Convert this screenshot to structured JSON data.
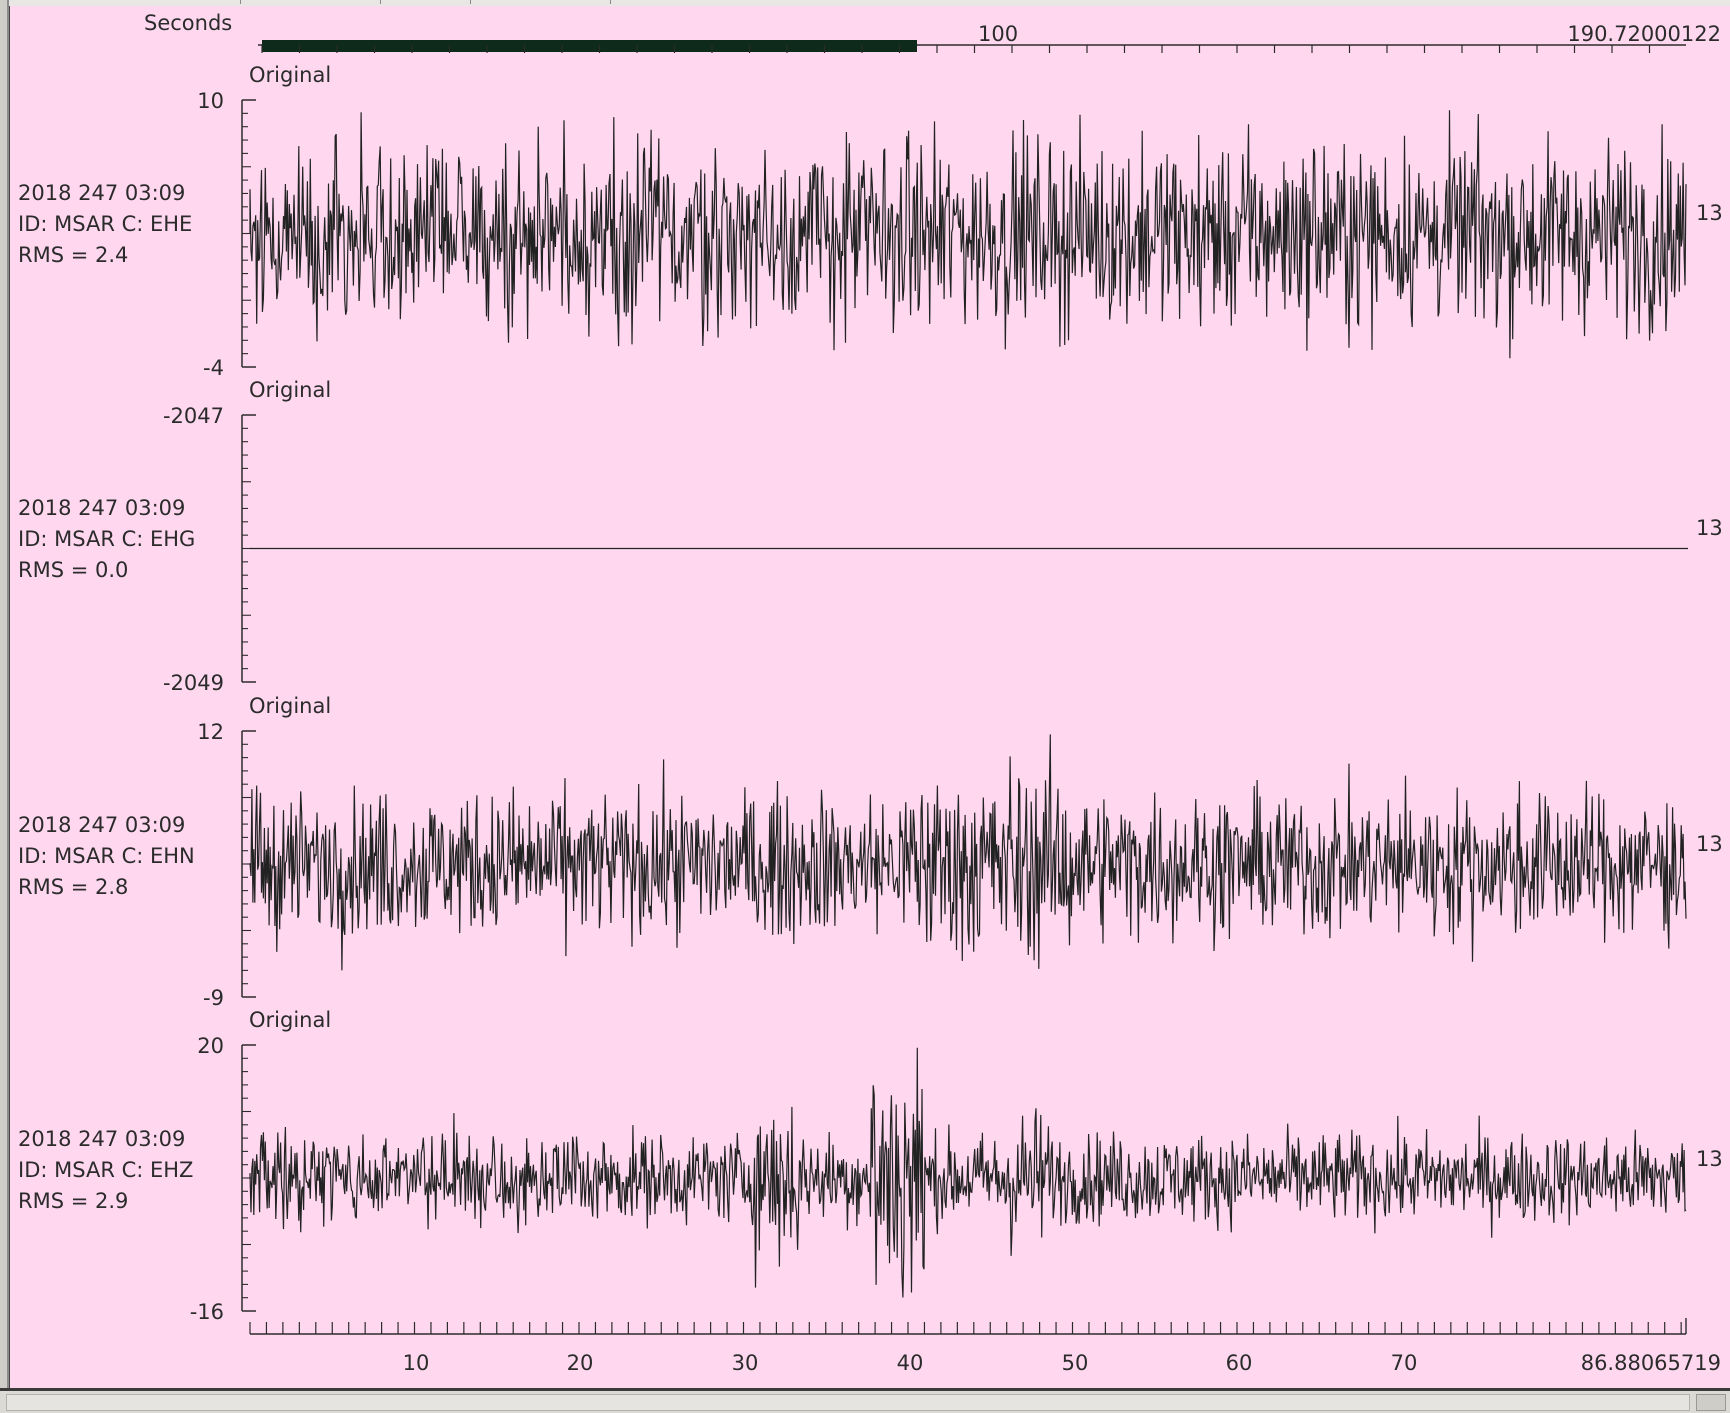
{
  "app": {
    "background": "#ffd8f0",
    "trace_color": "#222222",
    "overview_bar_color": "#0d2a1a"
  },
  "overview_axis": {
    "title": "Seconds",
    "mid_label": "100",
    "end_label": "190.72000122",
    "visible_window_fraction": 0.46
  },
  "time_axis": {
    "tick_labels": [
      "10",
      "20",
      "30",
      "40",
      "50",
      "60",
      "70",
      "86.88065719"
    ]
  },
  "traces": [
    {
      "mode": "Original",
      "date": "2018 247 03:09",
      "id": "ID: MSAR C: EHE",
      "rms": "RMS = 2.4",
      "ymax": "10",
      "ymin": "-4",
      "right_label": "13",
      "amplitude": 0.45
    },
    {
      "mode": "Original",
      "date": "2018 247 03:09",
      "id": "ID: MSAR C: EHG",
      "rms": "RMS = 0.0",
      "ymax": "-2047",
      "ymin": "-2049",
      "right_label": "13",
      "amplitude": 0
    },
    {
      "mode": "Original",
      "date": "2018 247 03:09",
      "id": "ID: MSAR C: EHN",
      "rms": "RMS = 2.8",
      "ymax": "12",
      "ymin": "-9",
      "right_label": "13",
      "amplitude": 0.35
    },
    {
      "mode": "Original",
      "date": "2018 247 03:09",
      "id": "ID: MSAR C: EHZ",
      "rms": "RMS = 2.9",
      "ymax": "20",
      "ymin": "-16",
      "right_label": "13",
      "amplitude": 0.22
    }
  ]
}
